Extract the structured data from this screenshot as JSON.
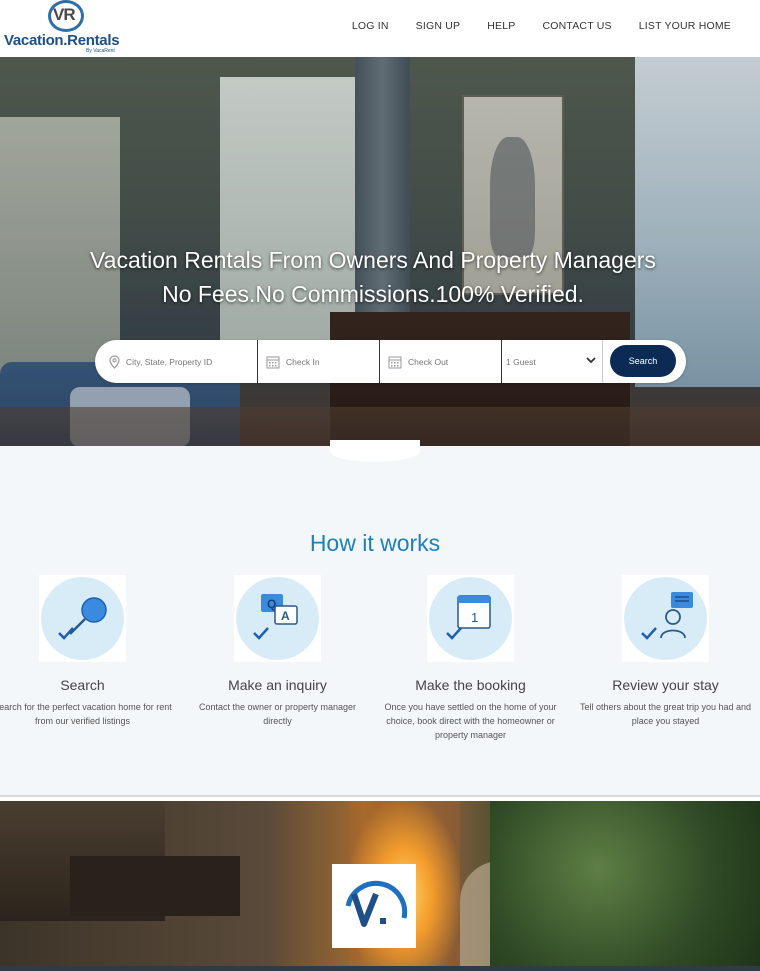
{
  "header": {
    "logo_mark": "VR",
    "logo_text": "Vacation.Rentals",
    "logo_sub": "By VacaRent",
    "nav": [
      "LOG IN",
      "SIGN UP",
      "HELP",
      "CONTACT US",
      "LIST YOUR HOME"
    ]
  },
  "hero": {
    "title_line1": "Vacation Rentals From Owners And Property Managers",
    "title_line2": "No Fees.No Commissions.100% Verified."
  },
  "search": {
    "location_placeholder": "City, State, Property ID",
    "checkin_placeholder": "Check In",
    "checkout_placeholder": "Check Out",
    "guests_selected": "1 Guest",
    "button_label": "Search"
  },
  "how_it_works": {
    "title": "How it works",
    "steps": [
      {
        "icon": "search-magnifier-icon",
        "title": "Search",
        "desc": "Search for the perfect vacation home for rent from our verified listings"
      },
      {
        "icon": "chat-inquiry-icon",
        "title": "Make an inquiry",
        "desc": "Contact the owner or property manager directly"
      },
      {
        "icon": "calendar-booking-icon",
        "title": "Make the booking",
        "desc": "Once you have settled on the home of your choice, book direct with the homeowner or property manager"
      },
      {
        "icon": "review-person-icon",
        "title": "Review your stay",
        "desc": "Tell others about the great trip you had and place you stayed"
      }
    ]
  },
  "colors": {
    "brand_blue": "#1e4f86",
    "heading_blue": "#1f7fb8",
    "search_button": "#0b2b55",
    "icon_circle": "#d8ecf8"
  }
}
